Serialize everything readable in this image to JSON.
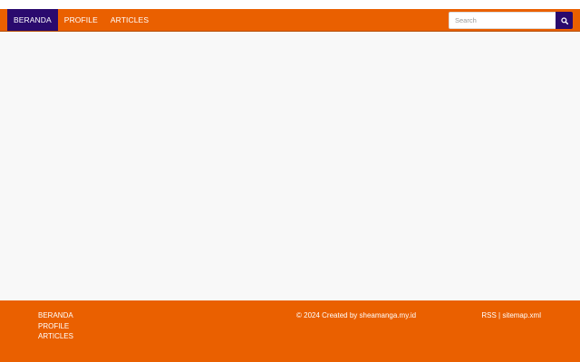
{
  "nav": {
    "items": [
      {
        "label": "BERANDA",
        "active": true
      },
      {
        "label": "PROFILE",
        "active": false
      },
      {
        "label": "ARTICLES",
        "active": false
      }
    ]
  },
  "search": {
    "placeholder": "Search",
    "icon": "search-icon"
  },
  "footer": {
    "links": [
      "BERANDA",
      "PROFILE",
      "ARTICLES"
    ],
    "copyright": "© 2024 Created by sheamanga.my.id",
    "rss_label": "RSS",
    "separator": " | ",
    "sitemap_label": "sitemap.xml"
  },
  "colors": {
    "accent": "#ea6000",
    "active": "#2a0a6e",
    "content_bg": "#f8f8f8"
  }
}
